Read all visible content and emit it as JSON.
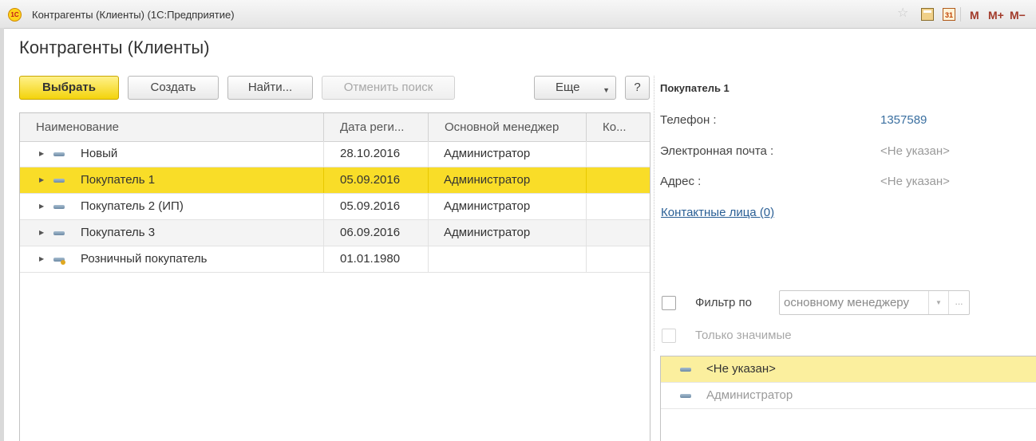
{
  "window": {
    "title": "Контрагенты (Клиенты)  (1С:Предприятие)",
    "logo_text": "1С",
    "calendar_day": "31",
    "memory_buttons": [
      "M",
      "M+",
      "M−"
    ]
  },
  "page_title": "Контрагенты (Клиенты)",
  "toolbar": {
    "select_label": "Выбрать",
    "create_label": "Создать",
    "find_label": "Найти...",
    "cancel_search_label": "Отменить поиск",
    "more_label": "Еще",
    "help_label": "?"
  },
  "grid": {
    "columns": [
      "Наименование",
      "Дата реги...",
      "Основной менеджер",
      "Ко..."
    ],
    "rows": [
      {
        "name": "Новый",
        "date": "28.10.2016",
        "manager": "Администратор",
        "selected": false
      },
      {
        "name": "Покупатель 1",
        "date": "05.09.2016",
        "manager": "Администратор",
        "selected": true
      },
      {
        "name": "Покупатель 2 (ИП)",
        "date": "05.09.2016",
        "manager": "Администратор",
        "selected": false
      },
      {
        "name": "Покупатель 3",
        "date": "06.09.2016",
        "manager": "Администратор",
        "selected": false
      },
      {
        "name": "Розничный покупатель",
        "date": "01.01.1980",
        "manager": "",
        "selected": false
      }
    ]
  },
  "card": {
    "name": "Покупатель 1",
    "phone_label": "Телефон :",
    "phone_value": "1357589",
    "email_label": "Электронная почта :",
    "email_value": "<Не указан>",
    "address_label": "Адрес :",
    "address_value": "<Не указан>",
    "contacts_link": "Контактные лица (0)"
  },
  "filter": {
    "label": "Фильтр по",
    "value": "основному менеджеру",
    "more": "...",
    "only_significant_label": "Только значимые"
  },
  "managers": [
    {
      "label": "<Не указан>",
      "selected": true
    },
    {
      "label": "Администратор",
      "selected": false
    }
  ],
  "colors": {
    "accent_yellow": "#f9dd28",
    "link_blue": "#2a5f95"
  }
}
